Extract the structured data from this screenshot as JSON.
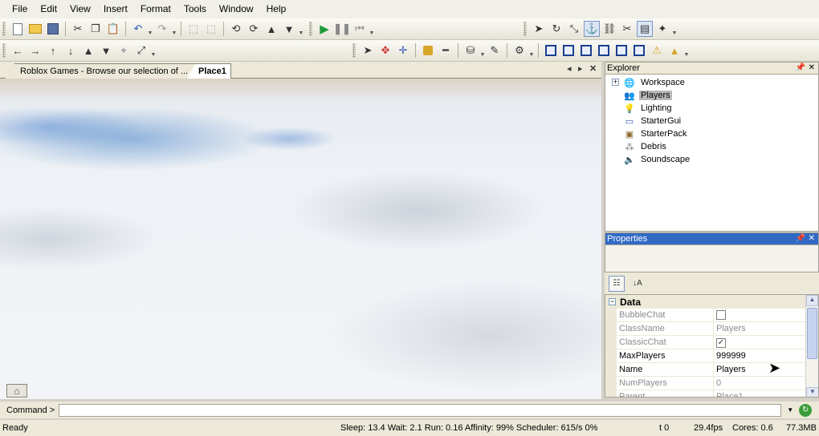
{
  "menu": [
    "File",
    "Edit",
    "View",
    "Insert",
    "Format",
    "Tools",
    "Window",
    "Help"
  ],
  "toolbar1": {
    "left_icons": [
      "new-page-icon",
      "open-folder-icon",
      "save-disk-icon",
      "cut-icon",
      "copy-icon",
      "paste-icon",
      "undo-icon",
      "redo-icon",
      "group-icon",
      "ungroup-icon",
      "rotate-left-icon",
      "rotate-right-icon",
      "up-icon",
      "down-icon"
    ],
    "run_icons": [
      "play-icon",
      "pause-icon",
      "stop-icon"
    ],
    "right_icons": [
      "select-arrow-icon",
      "rotate-tool-icon",
      "resize-tool-icon",
      "anchor-icon",
      "weld-icon",
      "unweld-icon",
      "toolbox-icon",
      "materials-icon"
    ]
  },
  "toolbar2": {
    "camera_icons": [
      "pan-left-icon",
      "pan-right-icon",
      "tilt-up-icon",
      "tilt-down-icon",
      "zoom-in-icon",
      "zoom-out-icon",
      "look-at-icon",
      "zoom-extents-icon"
    ],
    "tool_icons": [
      "select-icon",
      "move-icon",
      "drag-icon",
      "lock-icon",
      "dropper-icon",
      "fill-icon",
      "paint-icon",
      "wrench-icon",
      "surface-smooth-icon",
      "surface-glue-icon",
      "surface-weld-icon",
      "surface-studs-icon",
      "surface-inlet-icon",
      "surface-universal-icon",
      "hinge-icon",
      "motor-icon"
    ]
  },
  "tabs": {
    "tab1_label": "Roblox Games - Browse our selection of ...",
    "tab2_label": "Place1"
  },
  "explorer": {
    "title": "Explorer",
    "items": [
      {
        "label": "Workspace",
        "icon": "globe-icon",
        "expandable": true
      },
      {
        "label": "Players",
        "icon": "players-icon",
        "selected": true
      },
      {
        "label": "Lighting",
        "icon": "bulb-icon"
      },
      {
        "label": "StarterGui",
        "icon": "gui-icon"
      },
      {
        "label": "StarterPack",
        "icon": "pack-icon"
      },
      {
        "label": "Debris",
        "icon": "debris-icon"
      },
      {
        "label": "Soundscape",
        "icon": "speaker-icon"
      }
    ]
  },
  "properties": {
    "title": "Properties",
    "category": "Data",
    "rows": [
      {
        "name": "BubbleChat",
        "type": "checkbox",
        "checked": false,
        "editable": false
      },
      {
        "name": "ClassName",
        "value": "Players",
        "editable": false
      },
      {
        "name": "ClassicChat",
        "type": "checkbox",
        "checked": true,
        "editable": false
      },
      {
        "name": "MaxPlayers",
        "value": "999999",
        "editable": true
      },
      {
        "name": "Name",
        "value": "Players",
        "editable": true
      },
      {
        "name": "NumPlayers",
        "value": "0",
        "editable": false
      },
      {
        "name": "Parent",
        "value": "Place1",
        "editable": false
      }
    ]
  },
  "command": {
    "label": "Command >",
    "value": ""
  },
  "status": {
    "left": "Ready",
    "sleep": "Sleep: 13.4 Wait: 2.1 Run: 0.16 Affinity: 99% Scheduler: 615/s 0%",
    "t": "t 0",
    "fps": "29.4fps",
    "cores": "Cores: 0.6",
    "memory": "77.3MB"
  }
}
